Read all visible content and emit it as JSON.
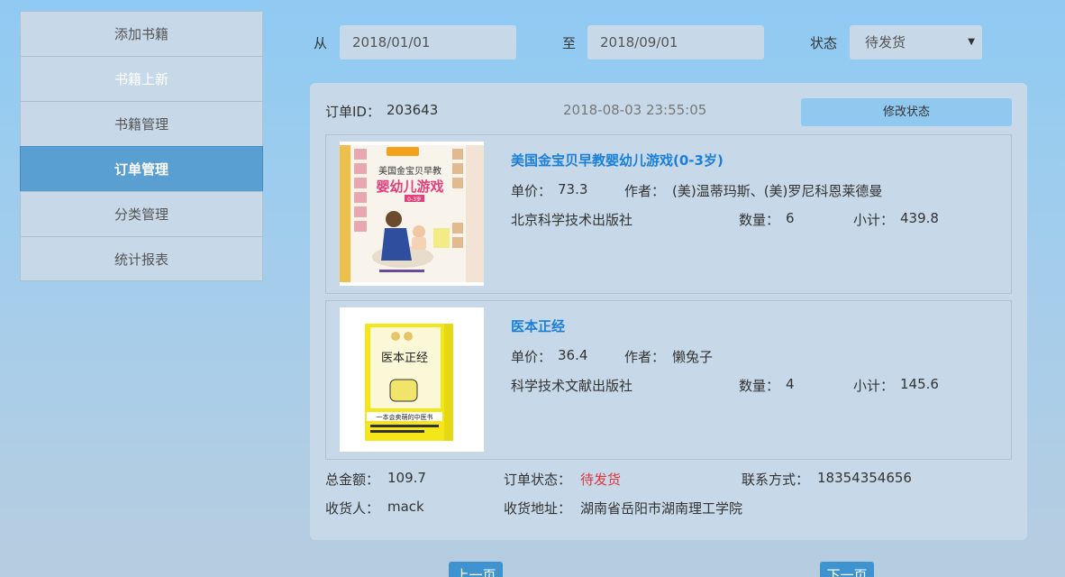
{
  "sidebar": {
    "items": [
      {
        "label": "添加书籍"
      },
      {
        "label": "书籍上新"
      },
      {
        "label": "书籍管理"
      },
      {
        "label": "订单管理"
      },
      {
        "label": "分类管理"
      },
      {
        "label": "统计报表"
      }
    ]
  },
  "filter": {
    "from_label": "从",
    "from_value": "2018/01/01",
    "to_label": "至",
    "to_value": "2018/09/01",
    "status_label": "状态",
    "status_value": "待发货"
  },
  "order": {
    "id_label": "订单ID：",
    "id": "203643",
    "datetime": "2018-08-03 23:55:05",
    "change_status_label": "修改状态",
    "items": [
      {
        "title": "美国金宝贝早教婴幼儿游戏(0-3岁)",
        "price_label": "单价：",
        "price": "73.3",
        "author_label": "作者：",
        "author": "(美)温蒂玛斯、(美)罗尼科恩莱德曼",
        "publisher": "北京科学技术出版社",
        "qty_label": "数量：",
        "qty": "6",
        "subtotal_label": "小计：",
        "subtotal": "439.8",
        "cover_text": {
          "line1": "美国金宝贝早教",
          "line2": "婴幼儿游戏",
          "line3": "0-3岁"
        }
      },
      {
        "title": "医本正经",
        "price_label": "单价：",
        "price": "36.4",
        "author_label": "作者：",
        "author": "懒兔子",
        "publisher": "科学技术文献出版社",
        "qty_label": "数量：",
        "qty": "4",
        "subtotal_label": "小计：",
        "subtotal": "145.6",
        "cover_text": {
          "line1": "医本正经",
          "line2": "一本会卖萌的中医书"
        }
      }
    ],
    "total_label": "总金额：",
    "total": "109.7",
    "status_label": "订单状态：",
    "status": "待发货",
    "contact_label": "联系方式：",
    "contact": "18354354656",
    "receiver_label": "收货人：",
    "receiver": "mack",
    "address_label": "收货地址：",
    "address": "湖南省岳阳市湖南理工学院"
  },
  "pager": {
    "prev_label": "上一页",
    "next_label": "下一页"
  },
  "colors": {
    "accent": "#5a9fd1",
    "link": "#1a7fd8",
    "status": "#e0353d"
  }
}
